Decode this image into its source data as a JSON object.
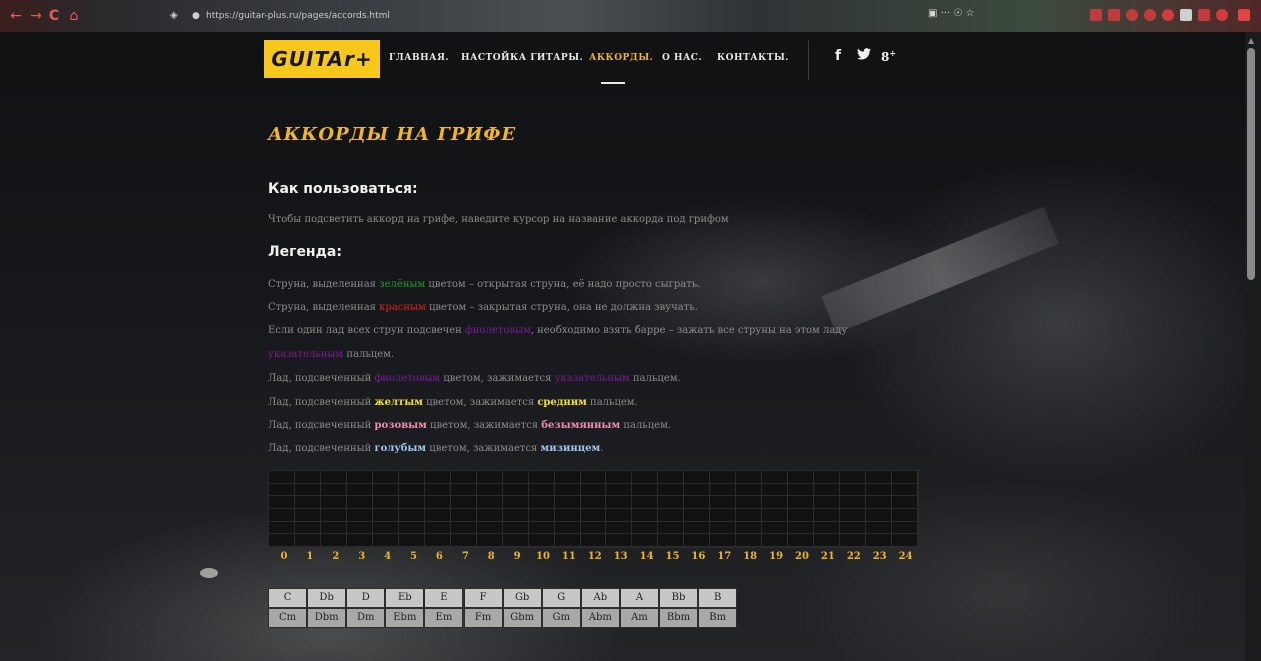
{
  "browser": {
    "url": "https://guitar-plus.ru/pages/accords.html",
    "nav_back": "←",
    "nav_forward": "→",
    "nav_reload": "C",
    "nav_home": "⌂",
    "shield": "◈",
    "lock": "🔒",
    "page_actions": "▣  ···  ☉  ☆"
  },
  "site": {
    "logo": "GUITAr+",
    "menu": [
      "ГЛАВНАЯ.",
      "НАСТОЙКА ГИТАРЫ.",
      "АККОРДЫ.",
      "О НАС.",
      "КОНТАКТЫ."
    ],
    "active_menu_index": 2,
    "social": [
      "f",
      "t",
      "g+"
    ]
  },
  "content": {
    "title": "АККОРДЫ НА ГРИФЕ",
    "howto_heading": "Как пользоваться:",
    "howto_text": "Чтобы подсветить аккорд на грифе, наведите курсор на название аккорда под грифом",
    "legend_heading": "Легенда:",
    "legend": [
      {
        "a": "Струна, выделенная ",
        "b": "зелёным",
        "c": " цветом – открытая струна, её надо просто сыграть."
      },
      {
        "a": "Струна, выделенная ",
        "b": "красным",
        "c": " цветом – закрытая струна, она не должна звучать."
      },
      {
        "a": "Если один лад всех струн подсвечен ",
        "b": "фиолетовым",
        "c": ", необходимо взять барре – зажать все струны на этом ладу"
      },
      {
        "a": "",
        "b": "указательным",
        "c": " пальцем."
      },
      {
        "a": "Лад, подсвеченный ",
        "b": "фиолетовым",
        "c": " цветом, зажимается ",
        "d": "указательным",
        "e": " пальцем."
      },
      {
        "a": "Лад, подсвеченный ",
        "b": "желтым",
        "c": " цветом, зажимается ",
        "d": "средним",
        "e": " пальцем."
      },
      {
        "a": "Лад, подсвеченный ",
        "b": "розовым",
        "c": " цветом, зажимается ",
        "d": "безымянным",
        "e": " пальцем."
      },
      {
        "a": "Лад, подсвеченный ",
        "b": "голубым",
        "c": " цветом, зажимается ",
        "d": "мизинцем",
        "e": "."
      }
    ]
  },
  "fretboard": {
    "strings": 6,
    "frets": 25,
    "fret_numbers": [
      "0",
      "1",
      "2",
      "3",
      "4",
      "5",
      "6",
      "7",
      "8",
      "9",
      "10",
      "11",
      "12",
      "13",
      "14",
      "15",
      "16",
      "17",
      "18",
      "19",
      "20",
      "21",
      "22",
      "23",
      "24"
    ]
  },
  "chords": {
    "major": [
      "C",
      "Db",
      "D",
      "Eb",
      "E",
      "F",
      "Gb",
      "G",
      "Ab",
      "A",
      "Bb",
      "B"
    ],
    "minor": [
      "Cm",
      "Dbm",
      "Dm",
      "Ebm",
      "Em",
      "Fm",
      "Gbm",
      "Gm",
      "Abm",
      "Am",
      "Bbm",
      "Bm"
    ]
  },
  "colors": {
    "accent": "#f2b61e",
    "logo_bg": "#f7c81b",
    "green": "#1f9d23",
    "red": "#e21c1c",
    "purple": "#7a1a9a",
    "yellow": "#f1e21c",
    "pink": "#f08cae",
    "blue": "#9fc6ef"
  }
}
